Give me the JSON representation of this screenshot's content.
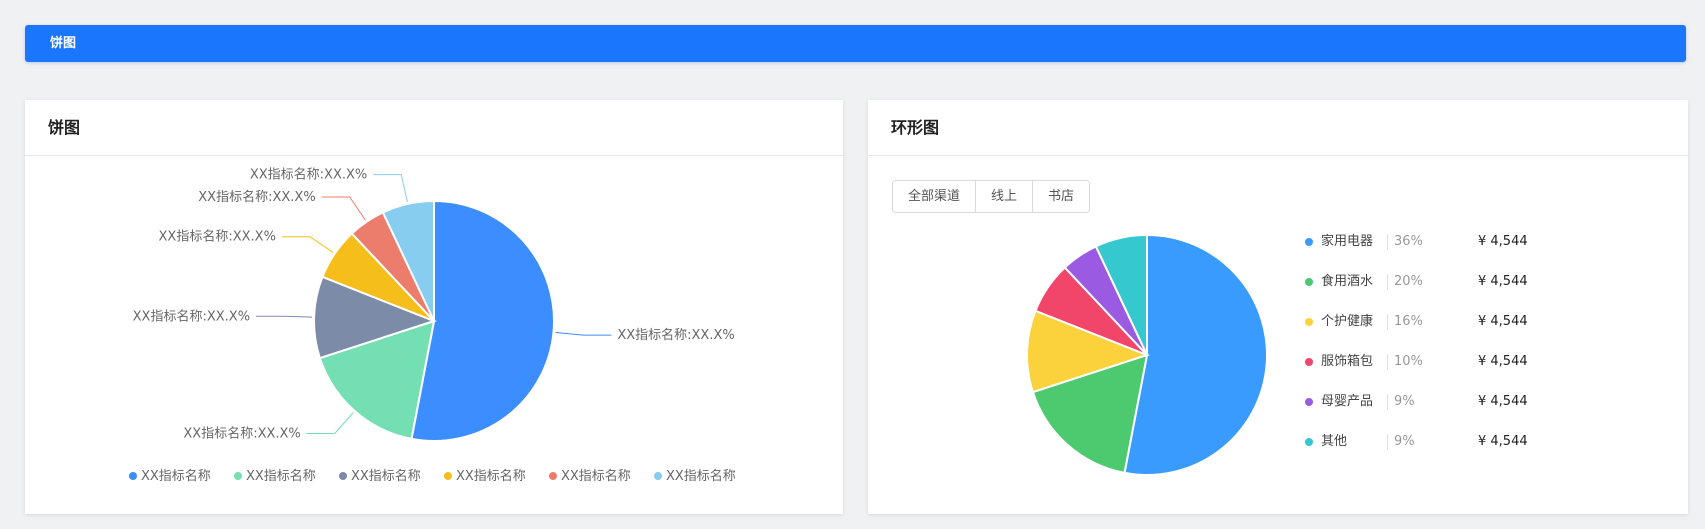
{
  "header": {
    "title": "饼图"
  },
  "pie_card": {
    "title": "饼图"
  },
  "donut_card": {
    "title": "环形图",
    "tabs": [
      "全部渠道",
      "线上",
      "书店"
    ]
  },
  "chart_data": [
    {
      "type": "pie",
      "title": "",
      "labels": [
        "XX指标名称:XX.X%",
        "XX指标名称:XX.X%",
        "XX指标名称:XX.X%",
        "XX指标名称:XX.X%",
        "XX指标名称:XX.X%",
        "XX指标名称:XX.X%"
      ],
      "series": [
        {
          "name": "XX指标名称",
          "value": 53,
          "color": "#3c8dff"
        },
        {
          "name": "XX指标名称",
          "value": 17,
          "color": "#73dfb3"
        },
        {
          "name": "XX指标名称",
          "value": 11,
          "color": "#7c8ba8"
        },
        {
          "name": "XX指标名称",
          "value": 7,
          "color": "#f6be1b"
        },
        {
          "name": "XX指标名称",
          "value": 5,
          "color": "#ec7c6c"
        },
        {
          "name": "XX指标名称",
          "value": 7,
          "color": "#86cdf0"
        }
      ],
      "legend_position": "bottom"
    },
    {
      "type": "pie",
      "title": "",
      "series": [
        {
          "name": "家用电器",
          "value": 53,
          "percent_label": "36%",
          "amount": "¥ 4,544",
          "color": "#3a9bff"
        },
        {
          "name": "食用酒水",
          "value": 17,
          "percent_label": "20%",
          "amount": "¥ 4,544",
          "color": "#4dca6f"
        },
        {
          "name": "个护健康",
          "value": 11,
          "percent_label": "16%",
          "amount": "¥ 4,544",
          "color": "#fbd23b"
        },
        {
          "name": "服饰箱包",
          "value": 7,
          "percent_label": "10%",
          "amount": "¥ 4,544",
          "color": "#f1456a"
        },
        {
          "name": "母婴产品",
          "value": 5,
          "percent_label": "9%",
          "amount": "¥ 4,544",
          "color": "#9a5be2"
        },
        {
          "name": "其他",
          "value": 7,
          "percent_label": "9%",
          "amount": "¥ 4,544",
          "color": "#36c8cf"
        }
      ],
      "legend_position": "right"
    }
  ]
}
